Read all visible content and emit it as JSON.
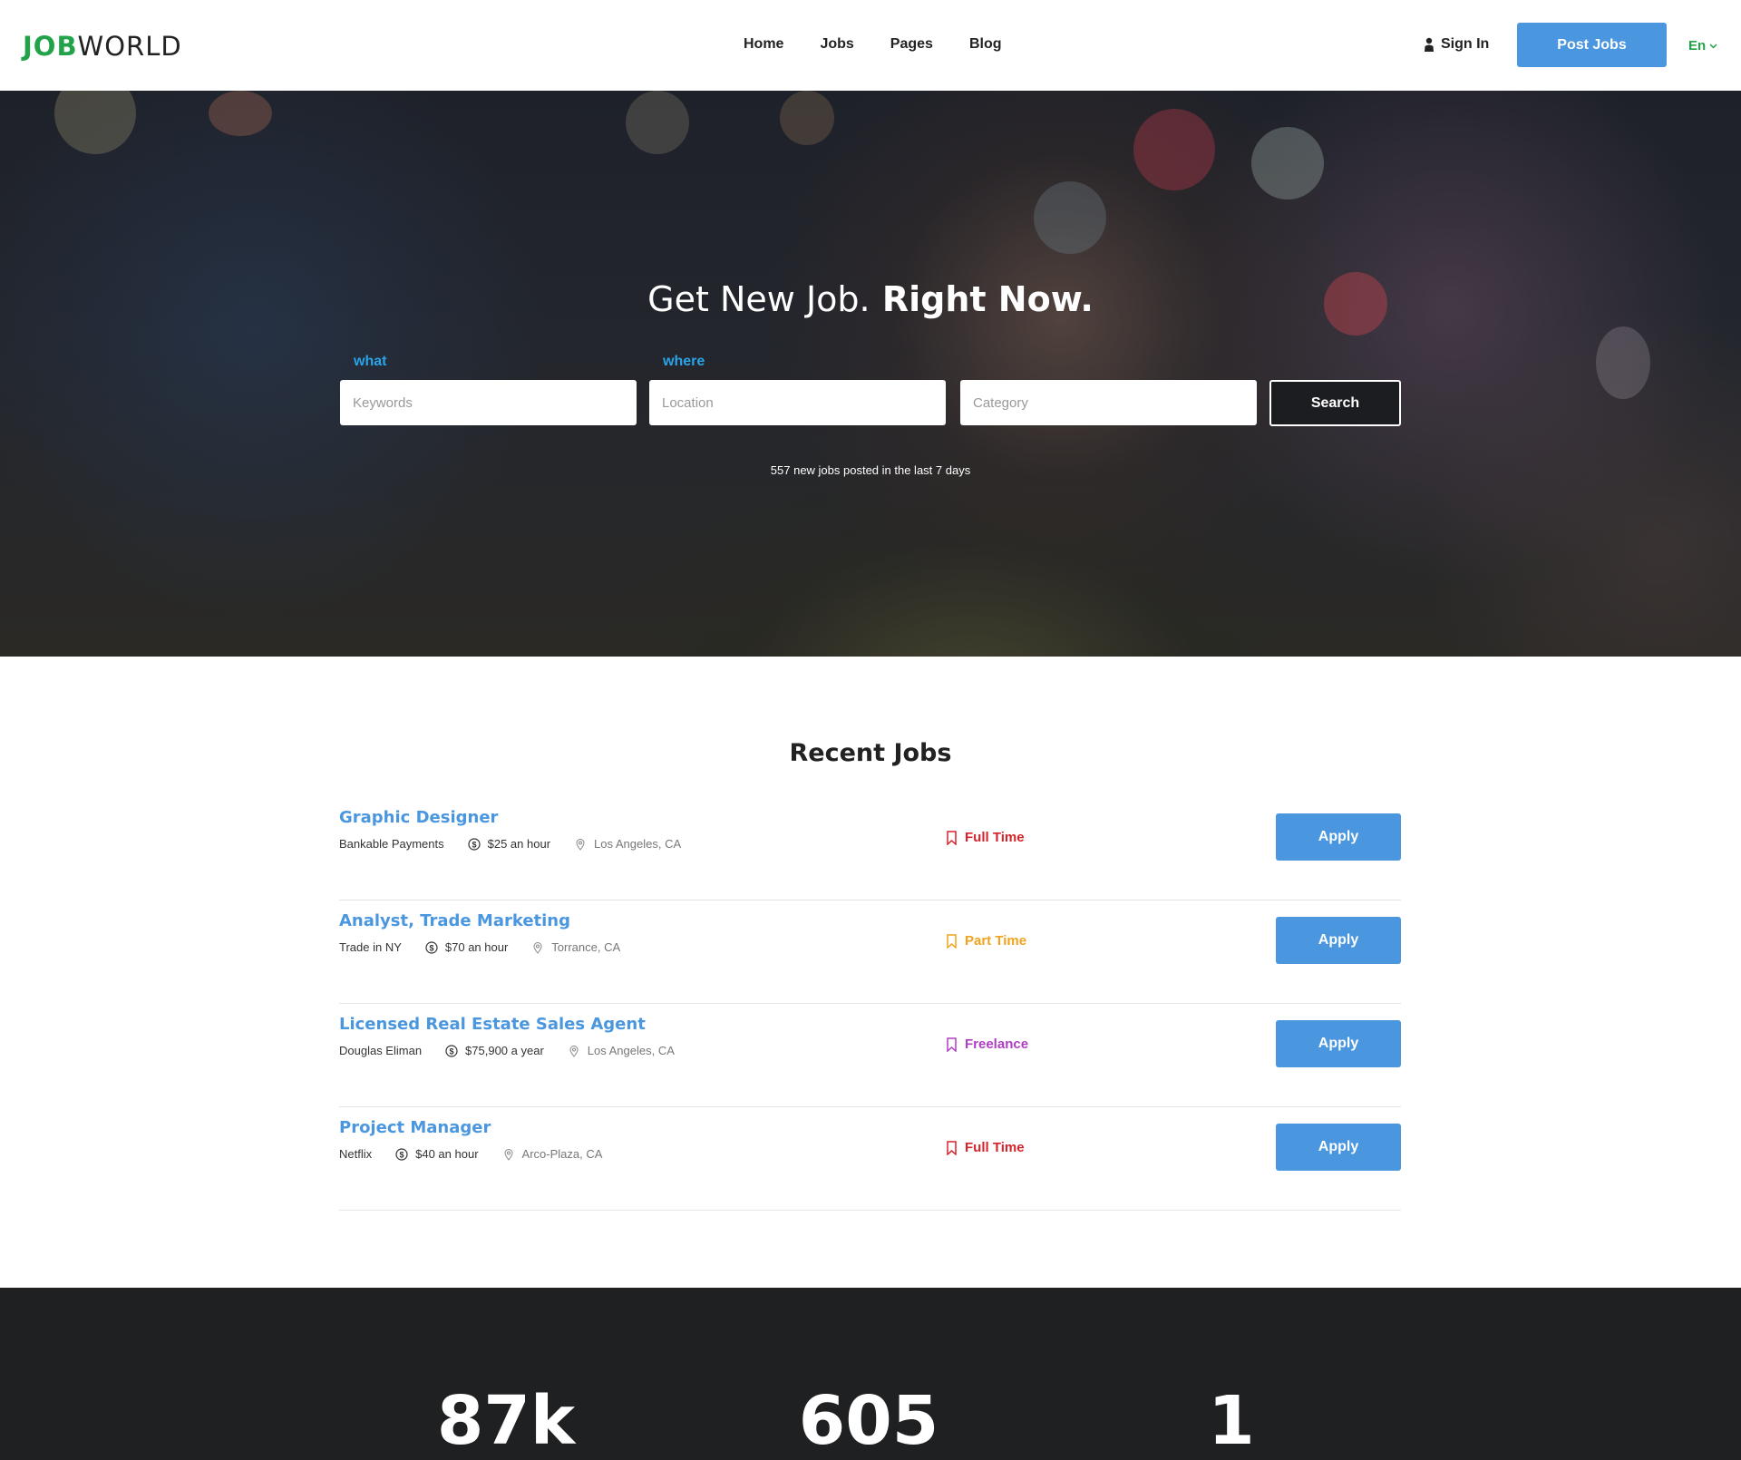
{
  "header": {
    "logo_bold": "JOB",
    "logo_light": "WORLD",
    "nav": [
      "Home",
      "Jobs",
      "Pages",
      "Blog"
    ],
    "sign_in": "Sign In",
    "post_jobs": "Post Jobs",
    "language": "En"
  },
  "hero": {
    "title_light": "Get New Job.",
    "title_bold": "Right Now.",
    "what_label": "what",
    "where_label": "where",
    "keywords_placeholder": "Keywords",
    "location_placeholder": "Location",
    "category_placeholder": "Category",
    "search_button": "Search",
    "note": "557 new jobs posted in the last 7 days"
  },
  "recent": {
    "title": "Recent Jobs",
    "jobs": [
      {
        "title": "Graphic Designer",
        "company": "Bankable Payments",
        "salary": "$25 an hour",
        "location": "Los Angeles, CA",
        "type": "Full Time",
        "type_color": "#d6232b",
        "apply": "Apply"
      },
      {
        "title": "Analyst, Trade Marketing",
        "company": "Trade in NY",
        "salary": "$70 an hour",
        "location": "Torrance, CA",
        "type": "Part Time",
        "type_color": "#f2a31b",
        "apply": "Apply"
      },
      {
        "title": "Licensed Real Estate Sales Agent",
        "company": "Douglas Eliman",
        "salary": "$75,900 a year",
        "location": "Los Angeles, CA",
        "type": "Freelance",
        "type_color": "#b03ec4",
        "apply": "Apply"
      },
      {
        "title": "Project Manager",
        "company": "Netflix",
        "salary": "$40 an hour",
        "location": "Arco-Plaza, CA",
        "type": "Full Time",
        "type_color": "#d6232b",
        "apply": "Apply"
      }
    ]
  },
  "stats": [
    "87k",
    "605",
    "1"
  ],
  "colors": {
    "accent": "#4a97e0",
    "brand_green": "#22a34a",
    "label_blue": "#2aa3e8"
  },
  "icons": [
    "user-icon",
    "chevron-down-icon",
    "dollar-icon",
    "map-pin-icon",
    "bookmark-icon"
  ]
}
